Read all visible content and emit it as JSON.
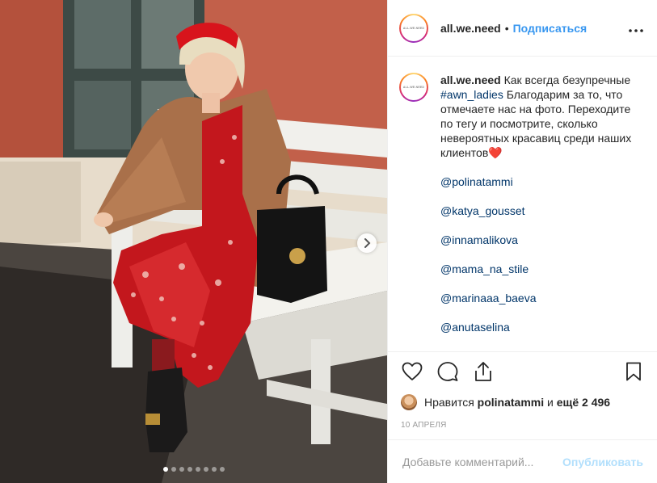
{
  "post": {
    "account": "all.we.need",
    "avatar_text": "ALL.WE.NEED",
    "separator": "•",
    "follow_label": "Подписаться",
    "more_icon": "more-horizontal-icon",
    "caption": {
      "text_before_tag": "Как всегда безупречные ",
      "hashtag": "#awn_ladies",
      "text_after_tag": " Благодарим за то, что отмечаете нас на фото. Переходите по тегу и посмотрите, сколько невероятных красавиц среди наших клиентов",
      "emoji": "❤️",
      "mentions": [
        "@polinatammi",
        "@katya_gousset",
        "@innamalikova",
        "@mama_na_stile",
        "@marinaaa_baeva",
        "@anutaselina"
      ]
    },
    "likes": {
      "prefix": "Нравится",
      "user": "polinatammi",
      "conj": "и",
      "others": "ещё 2 496"
    },
    "date": "10 АПРЕЛЯ",
    "comment": {
      "placeholder": "Добавьте комментарий...",
      "value": "",
      "post_label": "Опубликовать"
    },
    "carousel": {
      "slides": 8,
      "active_index": 0
    }
  }
}
